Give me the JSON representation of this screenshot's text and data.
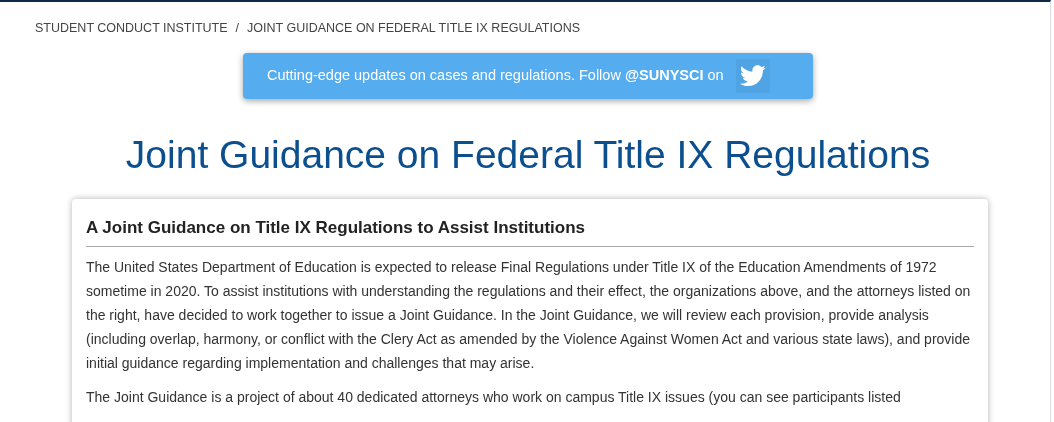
{
  "breadcrumb": [
    {
      "label": "STUDENT CONDUCT INSTITUTE"
    },
    {
      "label": "JOINT GUIDANCE ON FEDERAL TITLE IX REGULATIONS"
    }
  ],
  "breadcrumb_separator": "/",
  "banner": {
    "text": "Cutting-edge updates on cases and regulations. Follow **@SUNYSCI** on"
  },
  "page_title": "Joint Guidance on Federal Title IX Regulations",
  "card": {
    "heading": "A Joint Guidance on Title IX Regulations to Assist Institutions",
    "paragraphs": [
      "The United States Department of Education is expected to release Final Regulations under Title IX of the Education Amendments of 1972 sometime in 2020. To assist institutions with understanding the regulations and their effect, the organizations above, and the attorneys listed on the right, have decided to work together to issue a Joint Guidance. In the Joint Guidance, we will review each provision, provide analysis (including overlap, harmony, or conflict with the Clery Act as amended by the Violence Against Women Act and various state laws), and provide initial guidance regarding implementation and challenges that may arise.",
      "The Joint Guidance is a project of about 40 dedicated attorneys who work on campus Title IX issues (you can see participants listed"
    ]
  }
}
